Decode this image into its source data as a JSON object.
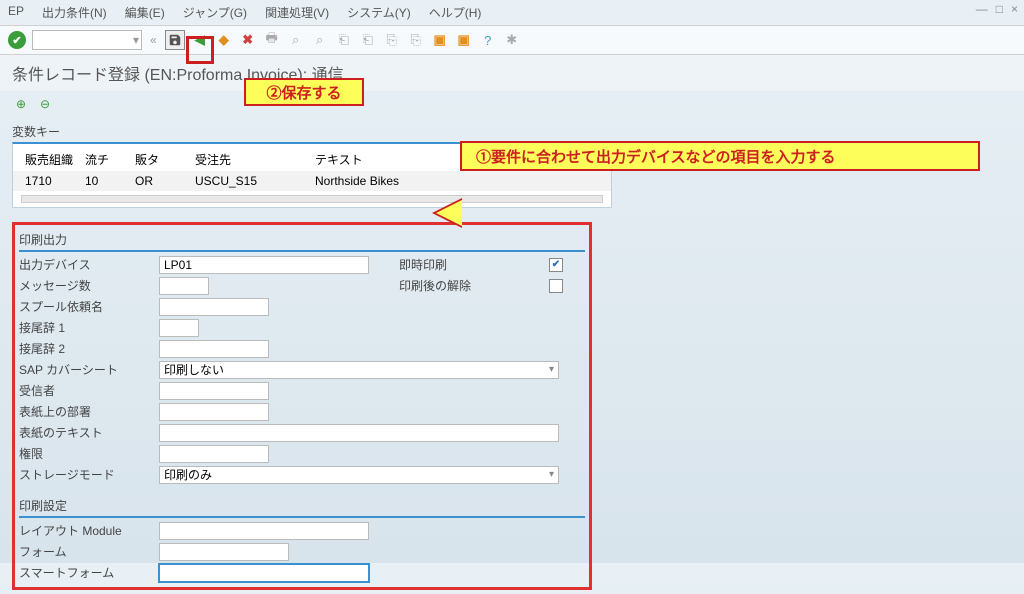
{
  "menu": [
    "EP",
    "出力条件(N)",
    "編集(E)",
    "ジャンプ(G)",
    "関連処理(V)",
    "システム(Y)",
    "ヘルプ(H)"
  ],
  "window_controls": [
    "—",
    "□",
    "×"
  ],
  "toolbar_dropdown_arrow": "▾",
  "toolbar_chev": "«",
  "title": "条件レコード登録 (EN:Proforma Invoice): 通信",
  "keys": {
    "group": "変数キー",
    "headers": [
      "販売組織",
      "流チ",
      "販タ",
      "受注先",
      "テキスト"
    ],
    "row": [
      "1710",
      "10",
      "OR",
      "USCU_S15",
      "Northside Bikes"
    ]
  },
  "print_out": {
    "head": "印刷出力",
    "device_label": "出力デバイス",
    "device_value": "LP01",
    "immediate_label": "即時印刷",
    "immediate_checked": "✔",
    "release_label": "印刷後の解除",
    "msgcount_label": "メッセージ数",
    "spool_label": "スプール依頼名",
    "suffix1_label": "接尾辞 1",
    "suffix2_label": "接尾辞 2",
    "cover_label": "SAP カバーシート",
    "cover_value": "印刷しない",
    "recipient_label": "受信者",
    "dept_label": "表紙上の部署",
    "covertext_label": "表紙のテキスト",
    "auth_label": "権限",
    "storage_label": "ストレージモード",
    "storage_value": "印刷のみ"
  },
  "print_set": {
    "head": "印刷設定",
    "layout_label": "レイアウト Module",
    "form_label": "フォーム",
    "smart_label": "スマートフォーム"
  },
  "annotations": {
    "a1": "①要件に合わせて出力デバイスなどの項目を入力する",
    "a2": "②保存する"
  }
}
